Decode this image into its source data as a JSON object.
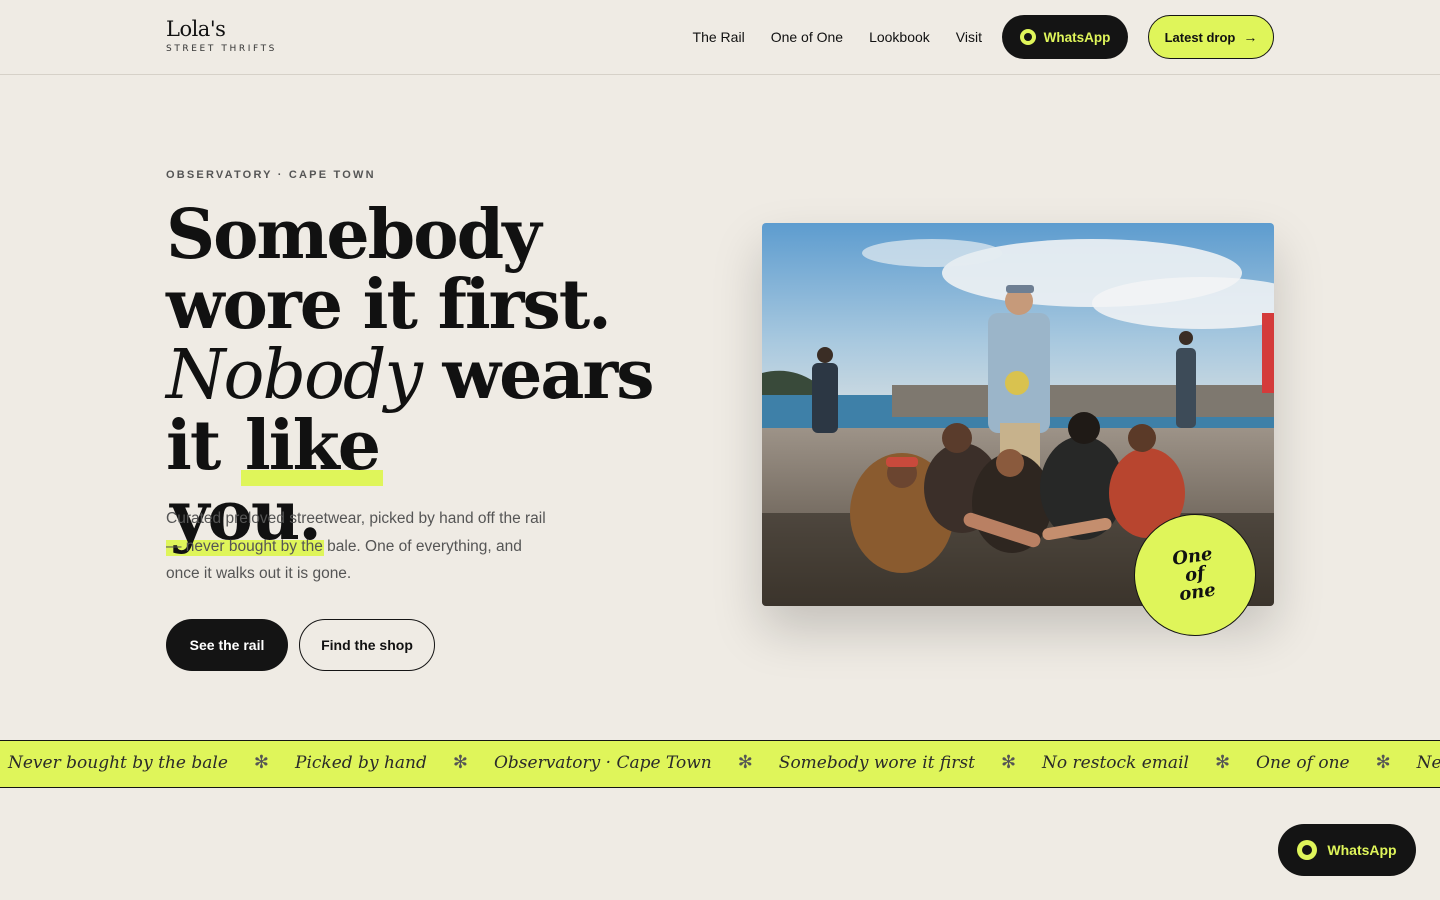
{
  "brand": {
    "name": "Lola's",
    "tagline": "STREET THRIFTS"
  },
  "nav": {
    "links": [
      "The Rail",
      "One of One",
      "Lookbook",
      "Visit"
    ],
    "whatsapp_label": "WhatsApp",
    "latest_drop_label": "Latest drop"
  },
  "hero": {
    "eyebrow": "OBSERVATORY · CAPE TOWN",
    "headline": {
      "part1": "Somebody wore it first. ",
      "italic": "Nobody",
      "part2": " wears it ",
      "highlight1": "like",
      "highlight2": "you."
    },
    "lede": "Curated preloved streetwear, picked by hand off the rail — never bought by the bale. One of everything, and once it walks out it is gone.",
    "primary_cta": "See the rail",
    "secondary_cta": "Find the shop"
  },
  "badge": {
    "line1": "One",
    "line2": "of",
    "line3": "one"
  },
  "marquee": {
    "items": [
      "Never bought by the bale",
      "Picked by hand",
      "Observatory · Cape Town",
      "Somebody wore it first",
      "No restock email",
      "One of one",
      "Never bought by the bale"
    ],
    "separator": "✻"
  },
  "floating": {
    "whatsapp_label": "WhatsApp"
  },
  "colors": {
    "accent": "#dff55a",
    "ink": "#141414",
    "background": "#efebe4"
  }
}
